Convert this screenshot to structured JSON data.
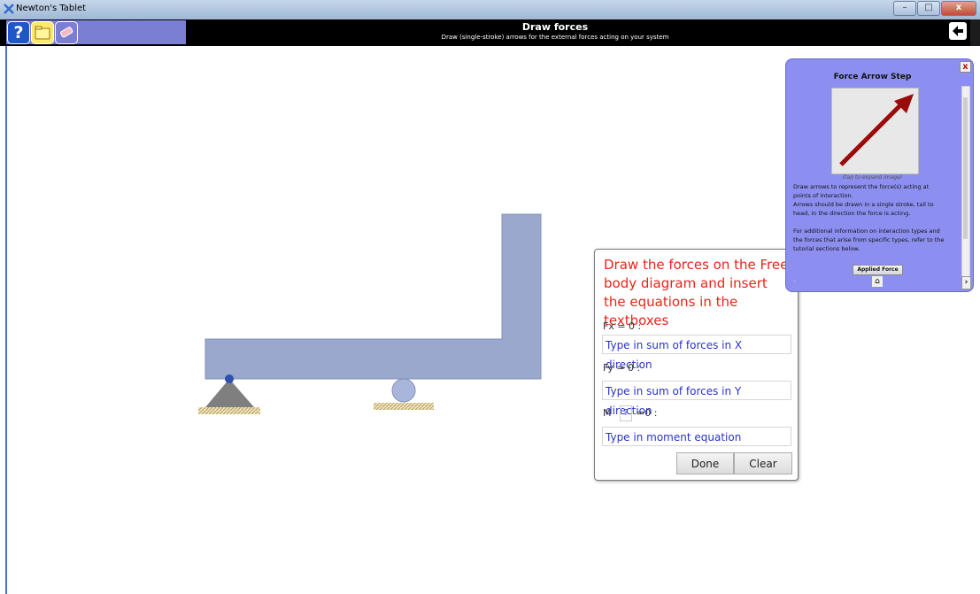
{
  "window": {
    "title": "Newton's Tablet",
    "controls": [
      "–",
      "□",
      "x"
    ]
  },
  "toolbar": {
    "help_glyph": "?",
    "title": "Draw forces",
    "subtitle": "Draw (single-stroke) arrows for the external forces acting on your system"
  },
  "hint_panel": {
    "instruction": "Draw the forces on the Free body diagram and insert the equations in the textboxes",
    "fx_label": "Fx = 0 :",
    "fx_placeholder": "Type in sum of forces in X direction",
    "fy_label": "Fy = 0 :",
    "fy_placeholder": "Type in sum of forces in Y direction",
    "moment_label_prefix": "M",
    "moment_point": "?",
    "moment_label_suffix": "=0 :",
    "moment_placeholder": "Type in moment equation",
    "done_label": "Done",
    "clear_label": "Clear"
  },
  "step_panel": {
    "title": "Force Arrow Step",
    "close_glyph": "x",
    "image_caption": "(tap to expand image)",
    "text_lines": [
      "Draw arrows to represent the force(s) acting at",
      "points of interaction.",
      " Arrows should be drawn in a single stroke, tail to",
      "head, in the direction the force is acting.",
      "",
      " For additional information on interaction types and",
      "the forces that arise from specific types, refer to the",
      "tutorial sections below."
    ],
    "applied_force_label": "Applied Force",
    "next_glyph": "›",
    "prev_glyph": "‹",
    "home_glyph": "⌂"
  },
  "colors": {
    "beam_fill": "#99a8cc",
    "beam_stroke": "#8391b8",
    "support_gray": "#7f7f7f",
    "ground_hatch": "#c8b37a",
    "instruction_red": "#e8241a",
    "panel_purple": "#8c8ff0",
    "arrow_dark_red": "#9b0a0a"
  }
}
